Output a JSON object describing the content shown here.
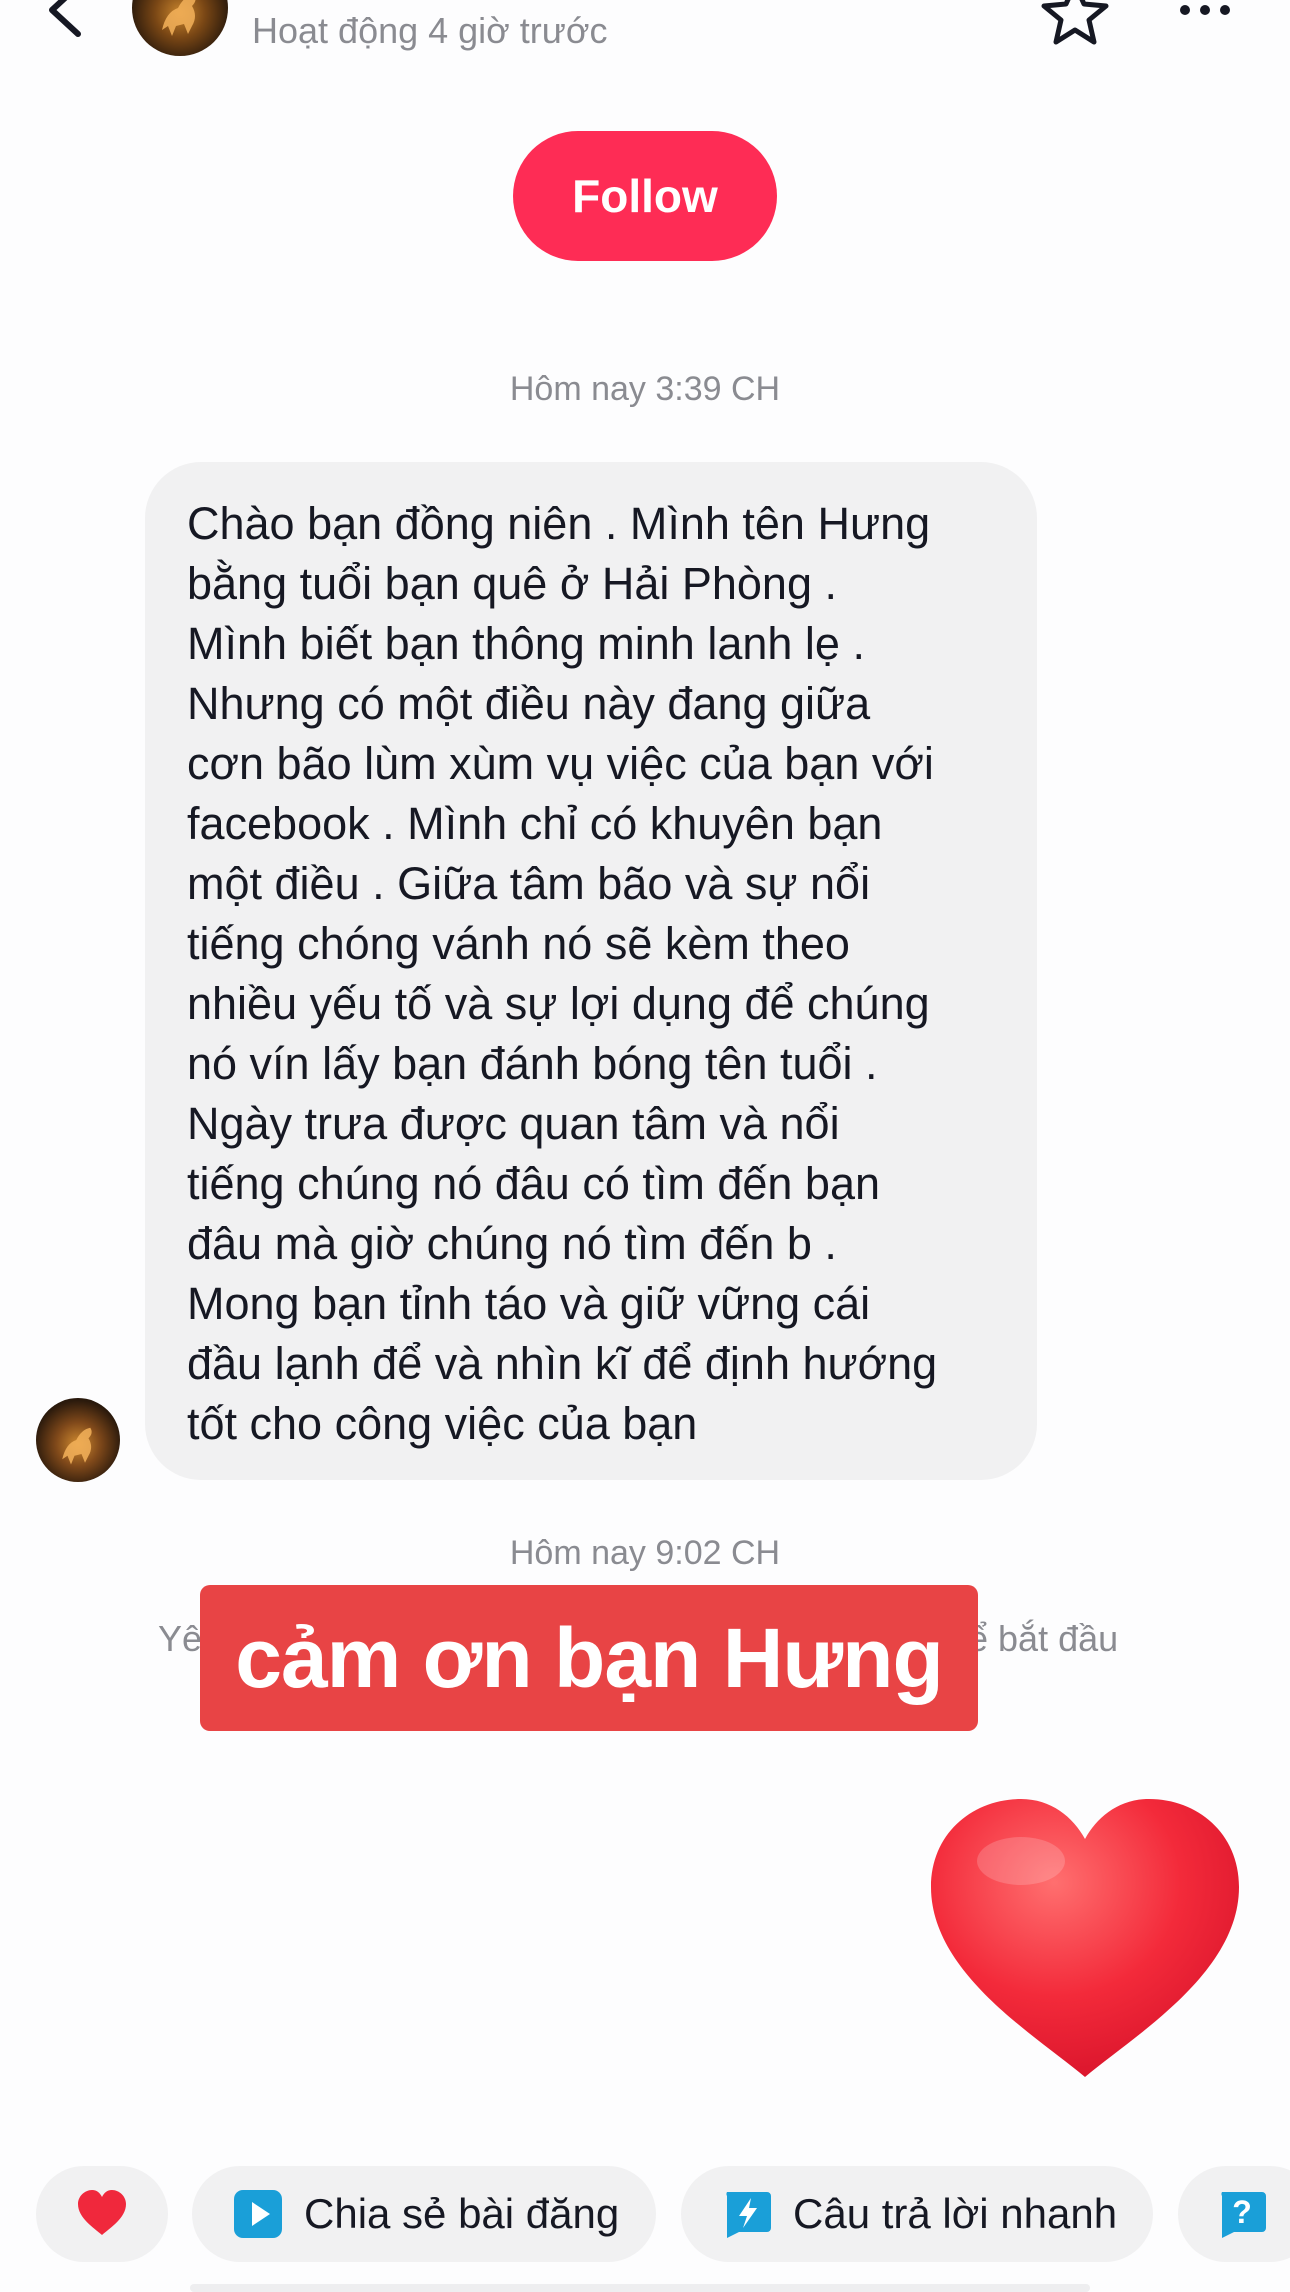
{
  "header": {
    "status": "Hoạt động 4 giờ trước",
    "back_icon": "chevron-left-icon",
    "favorite_icon": "star-outline-icon",
    "more_icon": "more-horizontal-icon"
  },
  "follow_button": {
    "label": "Follow",
    "color": "#fe2c55"
  },
  "conversation": {
    "timestamp_1": "Hôm nay 3:39 CH",
    "message_lines": [
      "Chào bạn đồng niên . Mình tên Hưng",
      "bằng tuổi bạn quê ở Hải Phòng .",
      "Mình biết bạn thông minh lanh lẹ .",
      "Nhưng có một điều này đang giữa",
      "cơn bão lùm xùm vụ việc của bạn với",
      "facebook . Mình chỉ có khuyên bạn",
      "một điều . Giữa tâm bão và sự nổi",
      "tiếng chóng vánh nó sẽ kèm theo",
      "nhiều yếu tố và sự lợi dụng để chúng",
      "nó vín lấy bạn đánh bóng tên tuổi .",
      "Ngày trưa được quan tâm và nổi",
      "tiếng chúng nó đâu có tìm đến bạn",
      "đâu mà giờ chúng nó tìm đến b .",
      "Mong bạn tỉnh táo và giữ vững cái",
      "đầu lạnh để và nhìn kĩ để định hướng",
      "tốt cho công việc của bạn"
    ],
    "timestamp_2": "Hôm nay 9:02 CH",
    "hint_left": "Yê",
    "hint_right": "ể bắt đầu",
    "caption": "cảm ơn bạn Hưng",
    "caption_color": "#e84445",
    "sent_sticker": "red-heart-emoji"
  },
  "quick_actions": {
    "heart_icon": "heart-emoji-icon",
    "share_label": "Chia sẻ bài đăng",
    "share_icon": "play-square-icon",
    "quick_reply_label": "Câu trả lời nhanh",
    "quick_reply_icon": "lightning-bubble-icon",
    "help_icon": "question-bubble-icon"
  }
}
